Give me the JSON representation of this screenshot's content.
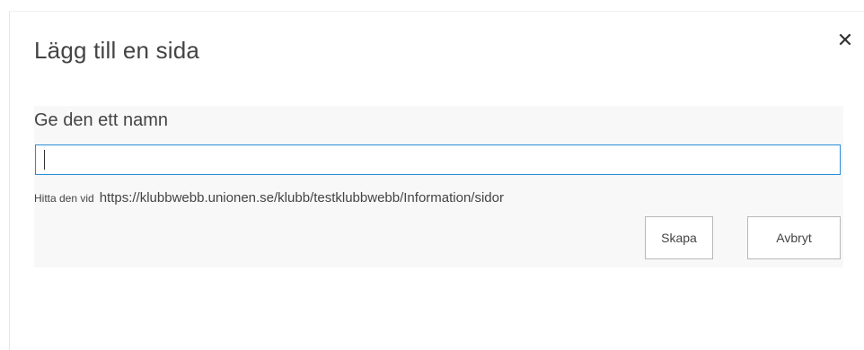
{
  "dialog": {
    "title": "Lägg till en sida",
    "close_glyph": "✕",
    "close_icon": "close-icon"
  },
  "form": {
    "name_label": "Ge den ett namn",
    "name_value": "",
    "url_prefix": "Hitta den vid",
    "url_value": "https://klubbwebb.unionen.se/klubb/testklubbwebb/Information/sidor"
  },
  "buttons": {
    "create_label": "Skapa",
    "cancel_label": "Avbryt"
  },
  "colors": {
    "input_focus_border": "#2a8dd4",
    "panel_background": "#f8f8f8"
  }
}
